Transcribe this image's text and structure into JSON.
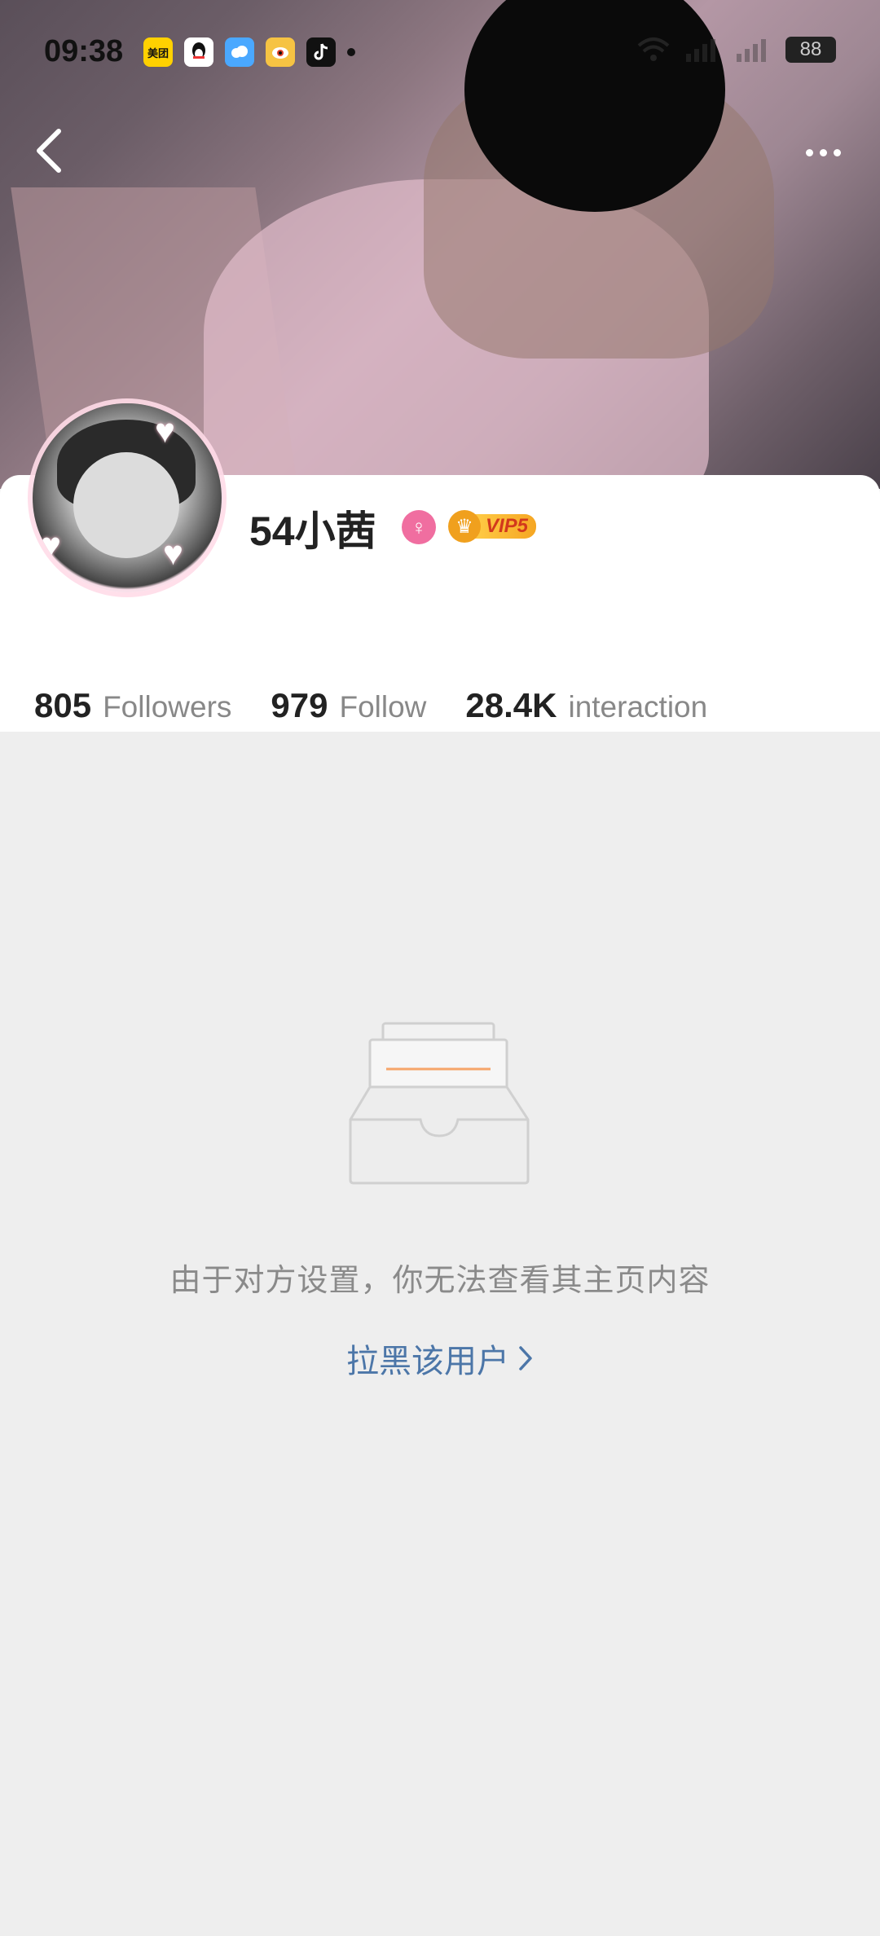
{
  "status_bar": {
    "time": "09:38",
    "app_icons": [
      {
        "name": "meituan-icon",
        "label": "美团",
        "color": "#ffd100"
      },
      {
        "name": "qq-icon",
        "label": "QQ",
        "color": "#ffffff"
      },
      {
        "name": "baidu-netdisk-icon",
        "label": "",
        "color": "#4aa8ff"
      },
      {
        "name": "weibo-icon",
        "label": "",
        "color": "#f6c343"
      },
      {
        "name": "tiktok-icon",
        "label": "",
        "color": "#111111"
      }
    ],
    "battery": "88"
  },
  "header": {
    "back_icon": "chevron-left-icon",
    "more_icon": "more-horizontal-icon"
  },
  "profile": {
    "username": "54小茜",
    "gender_symbol": "♀",
    "vip_label": "VIP5",
    "stats": [
      {
        "value": "805",
        "label": "Followers"
      },
      {
        "value": "979",
        "label": "Follow"
      },
      {
        "value": "28.4K",
        "label": "interaction"
      }
    ]
  },
  "empty_state": {
    "message": "由于对方设置，你无法查看其主页内容",
    "action_label": "拉黑该用户",
    "action_icon": "chevron-right-icon"
  },
  "colors": {
    "accent_link": "#4c76a8",
    "gender_pink": "#f06ea0",
    "vip_gold": "#f5a623",
    "page_bg": "#eeeeee"
  }
}
